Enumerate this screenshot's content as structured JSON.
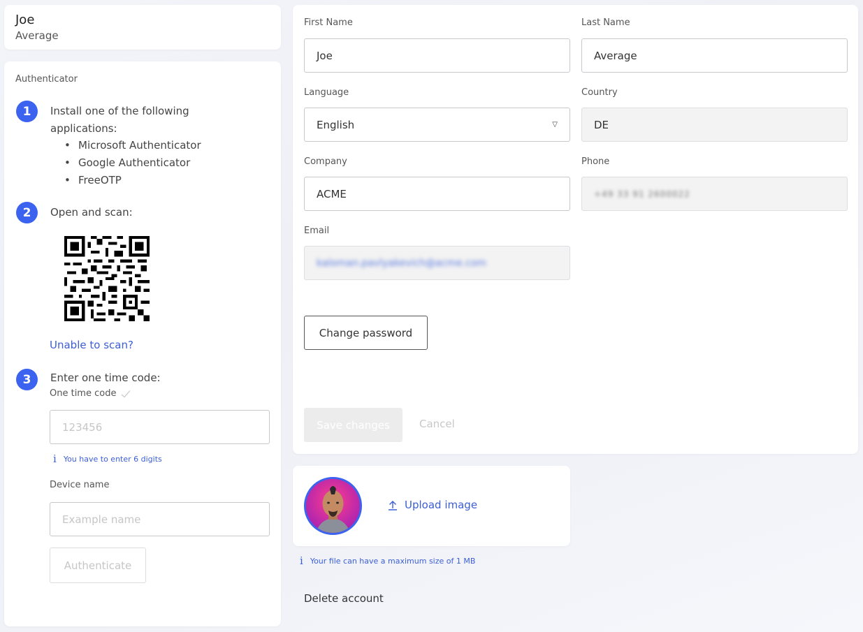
{
  "profile": {
    "first_name": "Joe",
    "last_name": "Average"
  },
  "authenticator": {
    "title": "Authenticator",
    "step1": {
      "num": "1",
      "text_line1": "Install one of the following",
      "text_line2": "applications:"
    },
    "apps": [
      "Microsoft Authenticator",
      "Google Authenticator",
      "FreeOTP"
    ],
    "step2": {
      "num": "2",
      "text": "Open and scan:"
    },
    "unable_to_scan": "Unable to scan?",
    "step3": {
      "num": "3",
      "text": "Enter one time code:"
    },
    "otp_label": "One time code",
    "otp_placeholder": "123456",
    "otp_hint": "You have to enter 6 digits",
    "device_label": "Device name",
    "device_placeholder": "Example name",
    "authenticate_label": "Authenticate"
  },
  "form": {
    "first_name_label": "First Name",
    "first_name_value": "Joe",
    "last_name_label": "Last Name",
    "last_name_value": "Average",
    "language_label": "Language",
    "language_value": "English",
    "country_label": "Country",
    "country_value": "DE",
    "company_label": "Company",
    "company_value": "ACME",
    "phone_label": "Phone",
    "phone_value": "+49 33 91 2600022",
    "email_label": "Email",
    "email_value": "kaloman.pavlyakevich@acme.com",
    "change_password_label": "Change password",
    "save_label": "Save changes",
    "cancel_label": "Cancel"
  },
  "avatar": {
    "upload_label": "Upload image",
    "size_hint": "Your file can have a maximum size of 1 MB"
  },
  "delete_account_label": "Delete account",
  "colors": {
    "accent": "#3b63f0",
    "link": "#3b5ed6",
    "avatar_bg": "#e6267a"
  },
  "icons": [
    "check-icon",
    "info-icon",
    "chevron-down-icon",
    "upload-icon",
    "qr-code"
  ]
}
